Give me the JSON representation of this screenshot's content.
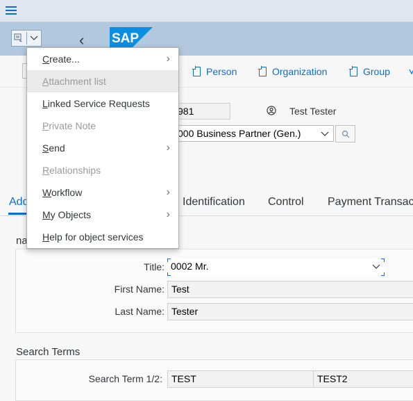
{
  "header": {
    "logo": "SAP"
  },
  "toolbar": {
    "buttons": [
      "Person",
      "Organization",
      "Group"
    ]
  },
  "bp": {
    "number_partial": "981",
    "user": "Test Tester",
    "role": "000 Business Partner (Gen.)"
  },
  "tabs": [
    "Add",
    "Identification",
    "Control",
    "Payment Transact"
  ],
  "name_section": {
    "title_partial": "na",
    "title_label": "Title:",
    "title_value": "0002 Mr.",
    "first_name_label": "First Name:",
    "first_name_value": "Test",
    "last_name_label": "Last Name:",
    "last_name_value": "Tester"
  },
  "search_terms": {
    "title": "Search Terms",
    "label": "Search Term 1/2:",
    "value1": "TEST",
    "value2": "TEST2"
  },
  "menu": {
    "items": [
      {
        "pre": "",
        "ul": "C",
        "post": "reate...",
        "disabled": false,
        "submenu": true
      },
      {
        "pre": "",
        "ul": "A",
        "post": "ttachment list",
        "disabled": true,
        "submenu": false
      },
      {
        "pre": "",
        "ul": "L",
        "post": "inked Service Requests",
        "disabled": false,
        "submenu": false
      },
      {
        "pre": "",
        "ul": "P",
        "post": "rivate Note",
        "disabled": true,
        "submenu": false
      },
      {
        "pre": "",
        "ul": "S",
        "post": "end",
        "disabled": false,
        "submenu": true
      },
      {
        "pre": "",
        "ul": "R",
        "post": "elationships",
        "disabled": true,
        "submenu": false
      },
      {
        "pre": "",
        "ul": "W",
        "post": "orkflow",
        "disabled": false,
        "submenu": true
      },
      {
        "pre": "",
        "ul": "M",
        "post": "y Objects",
        "disabled": false,
        "submenu": true
      },
      {
        "pre": "",
        "ul": "H",
        "post": "elp for object services",
        "disabled": false,
        "submenu": false
      }
    ]
  }
}
